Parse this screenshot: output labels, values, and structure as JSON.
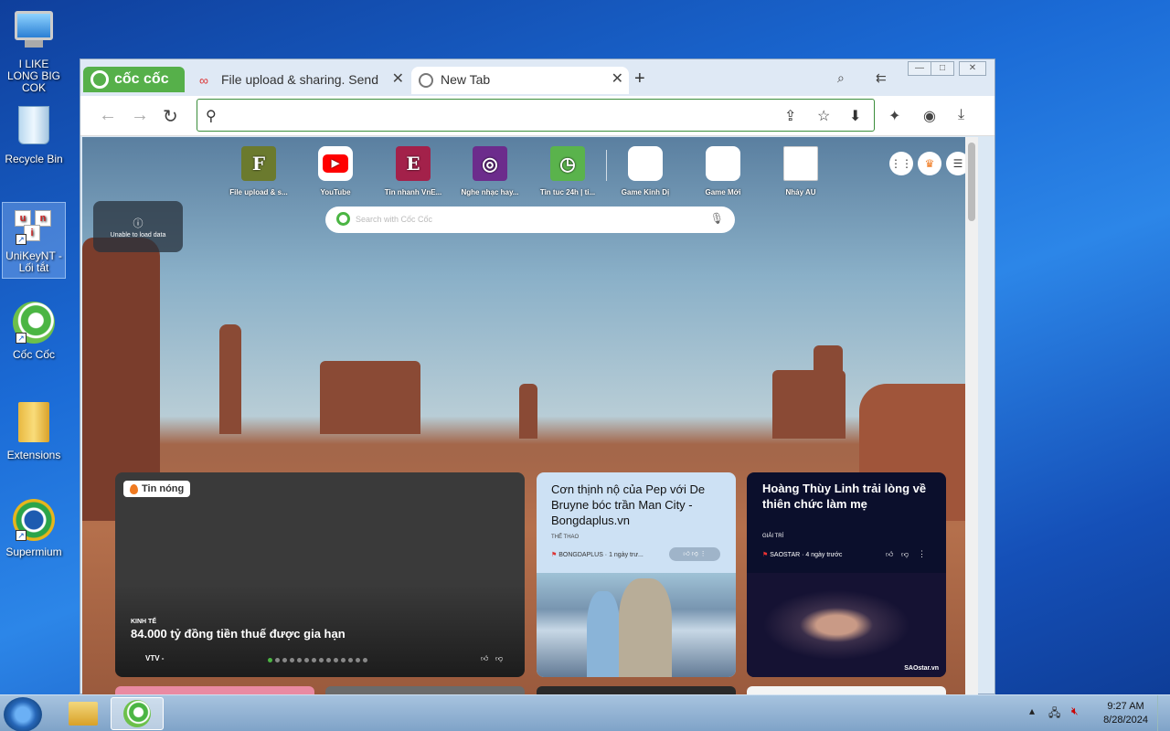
{
  "desktop": {
    "icons": [
      {
        "label": "I LIKE LONG BIG COK"
      },
      {
        "label": "Recycle Bin"
      },
      {
        "label": "UniKeyNT - Lối tắt"
      },
      {
        "label": "Cốc Cốc"
      },
      {
        "label": "Extensions"
      },
      {
        "label": "Supermium"
      }
    ]
  },
  "browser": {
    "brand": "cốc cốc",
    "tabs": [
      {
        "label": "File upload & sharing. Send"
      },
      {
        "label": "New Tab"
      }
    ],
    "omnibox": {
      "value": "",
      "placeholder": ""
    }
  },
  "newtab": {
    "speed_dial": [
      {
        "label": "File upload & s...",
        "glyph": "F",
        "color": "#6b7a2e"
      },
      {
        "label": "YouTube",
        "glyph": "▶",
        "color": "#ffffff"
      },
      {
        "label": "Tin nhanh VnE...",
        "glyph": "E",
        "color": "#a3214a"
      },
      {
        "label": "Nghe nhạc hay...",
        "glyph": "◎",
        "color": "#6c2c8c"
      },
      {
        "label": "Tin tuc 24h | ti...",
        "glyph": "◷",
        "color": "#5ab34c"
      },
      {
        "label": "Game Kinh Dị",
        "glyph": "",
        "color": "#ffffff"
      },
      {
        "label": "Game Mới",
        "glyph": "",
        "color": "#ffffff"
      },
      {
        "label": "Nhảy AU",
        "glyph": "",
        "color": "#ffffff"
      }
    ],
    "notice": "Unable to load data",
    "search_placeholder": "Search with Cốc Cốc",
    "hot_card": {
      "badge": "Tin nóng",
      "category": "KINH TẾ",
      "headline": "84.000 tỷ đồng tiền thuế được gia hạn",
      "source": "VTV -",
      "dots_total": 14,
      "dots_active": 1
    },
    "news": [
      {
        "title": "Cơn thịnh nộ của Pep với De Bruyne bóc trần Man City - Bongdaplus.vn",
        "category": "THỂ THAO",
        "source": "BONGDAPLUS · 1 ngày trư..."
      },
      {
        "title": "Hoàng Thùy Linh trải lòng về thiên chức làm mẹ",
        "category": "GIẢI TRÍ",
        "source": "SAOSTAR · 4 ngày trước",
        "photo_logo": "SAOstar.vn"
      }
    ]
  },
  "taskbar": {
    "time": "9:27 AM",
    "date": "8/28/2024"
  }
}
